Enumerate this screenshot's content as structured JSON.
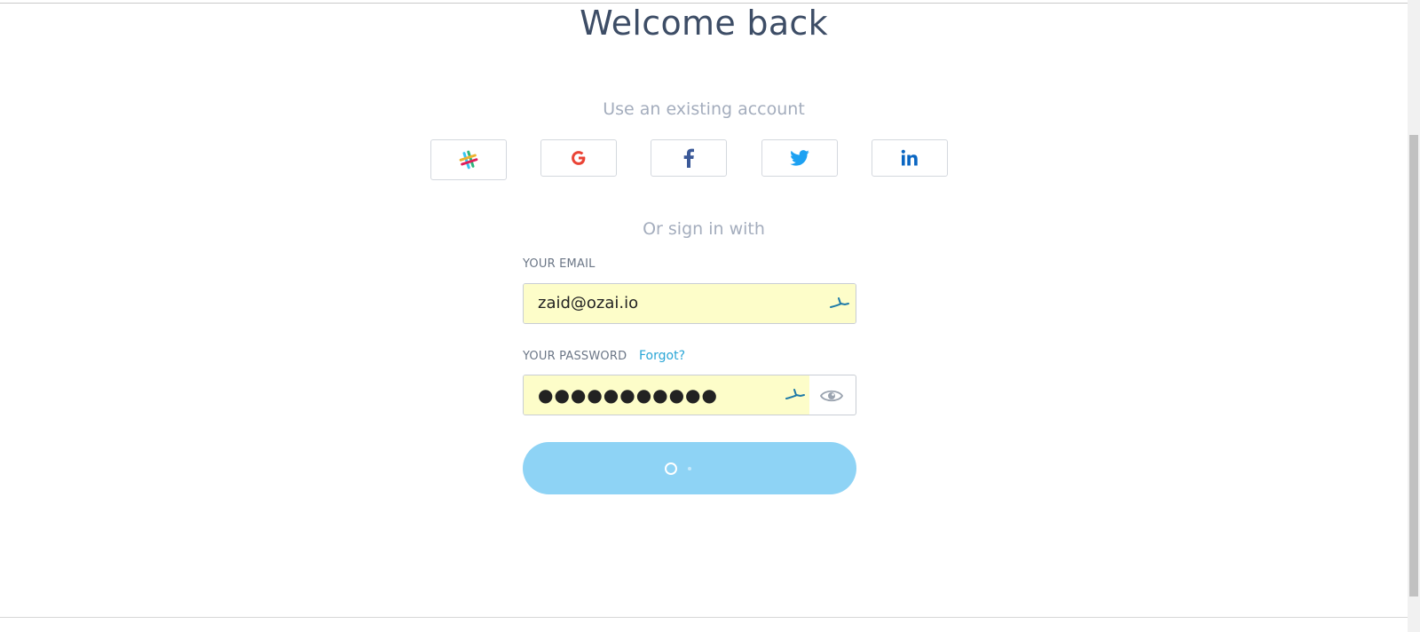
{
  "header": {
    "title": "Welcome back"
  },
  "social": {
    "heading": "Use an existing account",
    "providers": [
      {
        "name": "Slack",
        "icon": "slack-icon"
      },
      {
        "name": "Google",
        "icon": "google-icon"
      },
      {
        "name": "Facebook",
        "icon": "facebook-icon"
      },
      {
        "name": "Twitter",
        "icon": "twitter-icon"
      },
      {
        "name": "LinkedIn",
        "icon": "linkedin-icon"
      }
    ]
  },
  "form": {
    "divider_text": "Or sign in with",
    "email": {
      "label": "YOUR EMAIL",
      "value": "zaid@ozai.io",
      "autofill_icon": "autofill-key-icon"
    },
    "password": {
      "label": "YOUR PASSWORD",
      "forgot_label": "Forgot?",
      "masked_value": "●●●●●●●●●●●",
      "autofill_icon": "autofill-key-icon",
      "reveal_icon": "eye-icon"
    },
    "submit": {
      "state": "loading",
      "icon": "spinner-icon"
    }
  },
  "colors": {
    "title": "#3d4d66",
    "muted_text": "#a4adbd",
    "link": "#2aa6d6",
    "autofill_bg": "#fdfdc9",
    "submit_bg": "#8ed3f5",
    "google_red": "#ea4335",
    "facebook_blue": "#3b5998",
    "twitter_blue": "#1da1f2",
    "linkedin_blue": "#0a66c2"
  }
}
